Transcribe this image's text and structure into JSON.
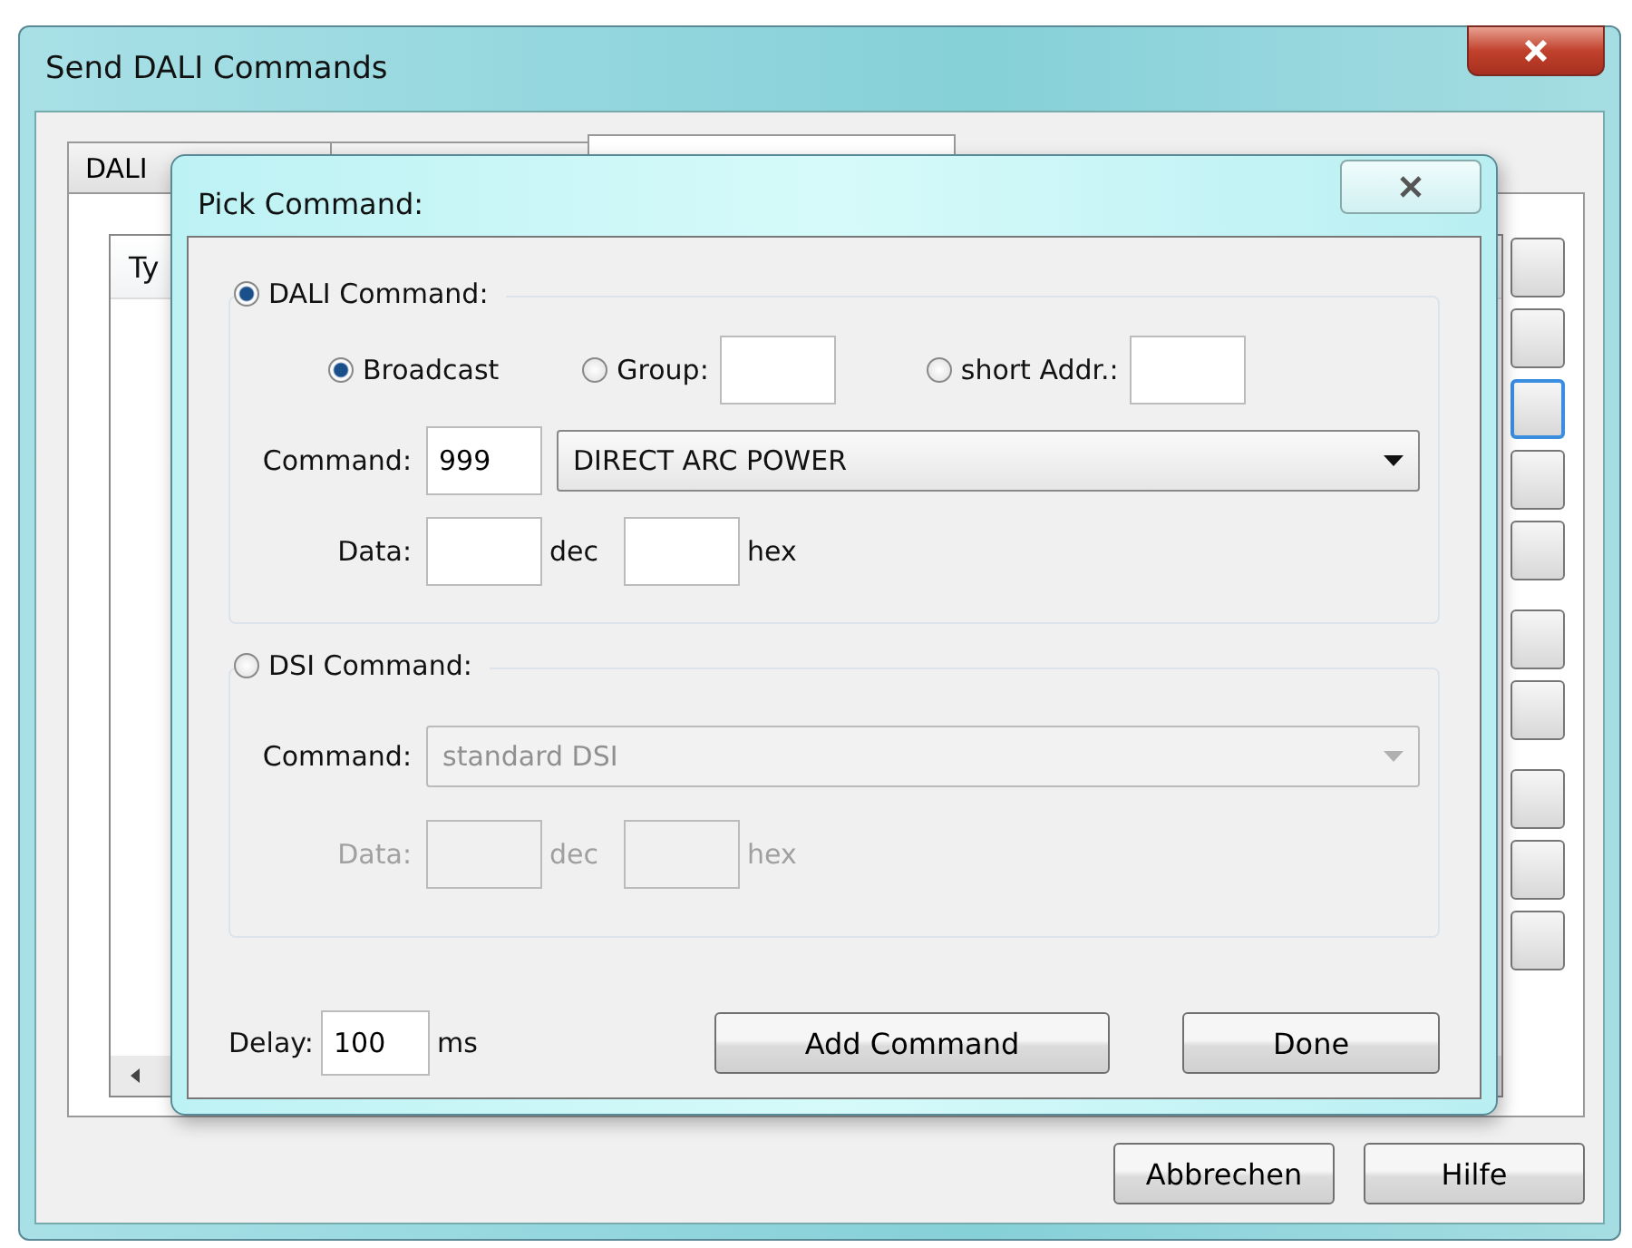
{
  "window": {
    "title": "Send DALI Commands"
  },
  "tabs": [
    {
      "label": "DALI",
      "selected": false
    },
    {
      "selected": false
    },
    {
      "selected": true
    }
  ],
  "list": {
    "columns": [
      "Ty"
    ]
  },
  "side_buttons": [
    {
      "focused": false
    },
    {
      "focused": false
    },
    {
      "focused": true
    },
    {
      "focused": false
    },
    {
      "focused": false
    },
    {
      "focused": false
    },
    {
      "focused": false
    },
    {
      "focused": false
    },
    {
      "focused": false
    },
    {
      "focused": false
    }
  ],
  "buttons": [
    "Abbrechen",
    "Hilfe"
  ],
  "dialog": {
    "title": "Pick Command:",
    "dali": {
      "label": "DALI Command:",
      "selected": true,
      "targets": [
        {
          "kind": "radio",
          "label": "Broadcast",
          "selected": true
        },
        {
          "kind": "radio-field",
          "label": "Group:",
          "selected": false
        },
        {
          "kind": "radio-field",
          "label": "short Addr.:",
          "selected": false
        }
      ],
      "command_label": "Command:",
      "command_value": "999",
      "command_choice": "DIRECT ARC POWER",
      "disabled": false,
      "data_label": "Data:",
      "dec_label": "dec",
      "hex_label": "hex"
    },
    "dsi": {
      "label": "DSI Command:",
      "selected": false,
      "command_label": "Command:",
      "command_choice": "standard DSI",
      "disabled": true,
      "data_label": "Data:",
      "dec_label": "dec",
      "hex_label": "hex"
    },
    "delay_label": "Delay:",
    "delay_value": "100",
    "delay_unit": "ms",
    "buttons": [
      "Add Command",
      "Done"
    ]
  }
}
